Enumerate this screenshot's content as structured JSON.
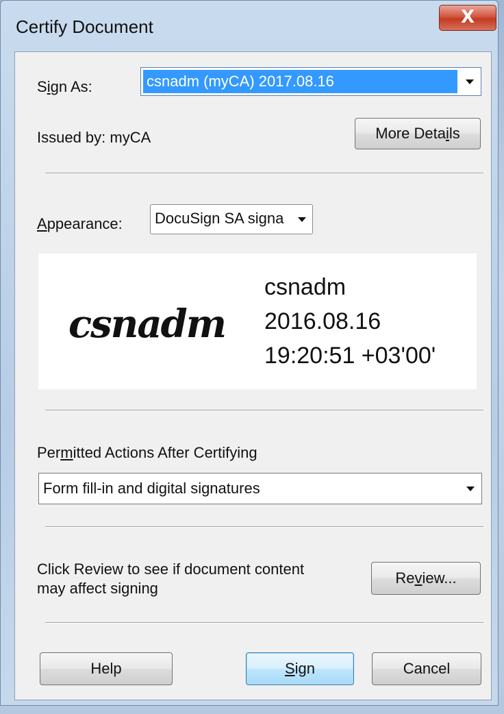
{
  "window": {
    "title": "Certify Document",
    "close_glyph": "X"
  },
  "sign_as": {
    "label": "Sign As:",
    "label_underline": "i",
    "value": "csnadm (myCA) 2017.08.16",
    "issued_by": "Issued by: myCA",
    "more_details": {
      "pre": "More Deta",
      "u": "i",
      "post": "ls"
    }
  },
  "appearance": {
    "label": {
      "pre": "",
      "u": "A",
      "post": "ppearance:"
    },
    "value": "DocuSign SA signa"
  },
  "signature_preview": {
    "script_name": "csnadm",
    "lines": [
      "csnadm",
      "2016.08.16",
      "19:20:51 +03'00'"
    ]
  },
  "permitted_actions": {
    "label": {
      "pre": "Per",
      "u": "m",
      "post": "itted Actions After Certifying"
    },
    "value": "Form fill-in and digital signatures"
  },
  "review": {
    "text_line1": "Click Review to see if document content",
    "text_line2": "may affect signing",
    "button": {
      "pre": "Re",
      "u": "v",
      "post": "iew..."
    }
  },
  "footer": {
    "help": "Help",
    "sign": {
      "pre": "",
      "u": "S",
      "post": "ign"
    },
    "cancel": "Cancel"
  }
}
